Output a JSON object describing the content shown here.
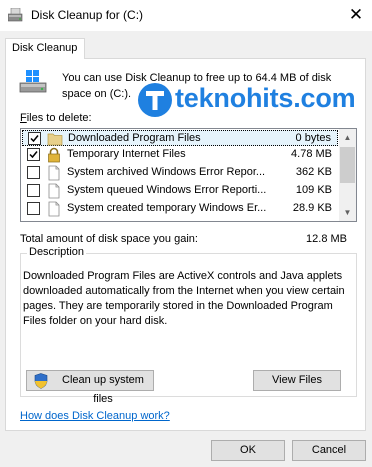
{
  "window": {
    "title": "Disk Cleanup for  (C:)",
    "close_glyph": "✕"
  },
  "tab": {
    "label": "Disk Cleanup"
  },
  "intro": {
    "text": "You can use Disk Cleanup to free up to 64.4 MB of disk space on  (C:)."
  },
  "watermark": {
    "text": "teknohits.com"
  },
  "files": {
    "label_prefix": "F",
    "label_rest": "iles to delete:",
    "items": [
      {
        "name": "Downloaded Program Files",
        "size": "0 bytes",
        "checked": true,
        "icon": "folder-icon"
      },
      {
        "name": "Temporary Internet Files",
        "size": "4.78 MB",
        "checked": true,
        "icon": "lock-icon"
      },
      {
        "name": "System archived Windows Error Repor...",
        "size": "362 KB",
        "checked": false,
        "icon": "file-icon"
      },
      {
        "name": "System queued Windows Error Reporti...",
        "size": "109 KB",
        "checked": false,
        "icon": "file-icon"
      },
      {
        "name": "System created temporary Windows Er...",
        "size": "28.9 KB",
        "checked": false,
        "icon": "file-icon"
      }
    ]
  },
  "total": {
    "label": "Total amount of disk space you gain:",
    "value": "12.8 MB"
  },
  "description": {
    "title": "Description",
    "text": "Downloaded Program Files are ActiveX controls and Java applets downloaded automatically from the Internet when you view certain pages. They are temporarily stored in the Downloaded Program Files folder on your hard disk."
  },
  "buttons": {
    "cleanup_system": "Clean up system files",
    "view_files": "View Files",
    "ok": "OK",
    "cancel": "Cancel"
  },
  "help_link": "How does Disk Cleanup work?",
  "colors": {
    "link": "#0066cc",
    "watermark": "#1f80e0",
    "selection": "#e5f3fb"
  }
}
